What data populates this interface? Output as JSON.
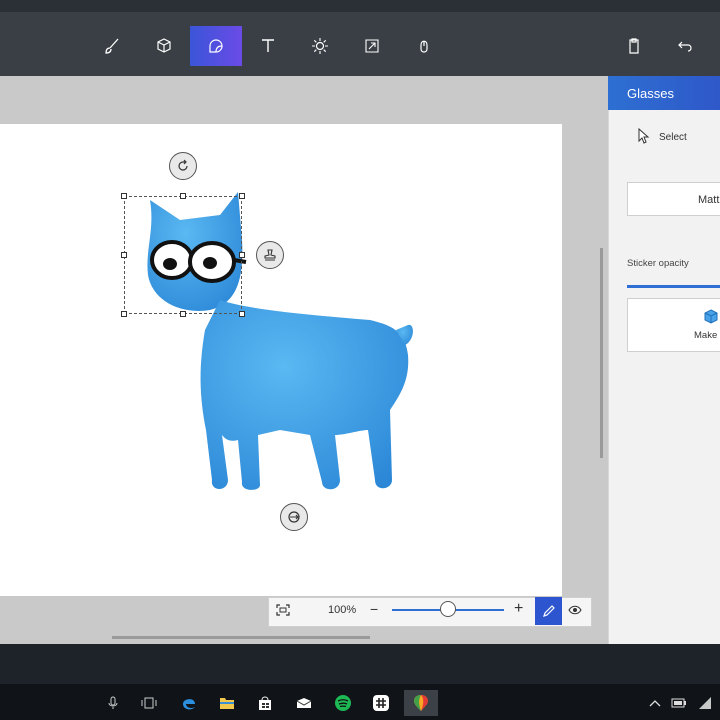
{
  "toolbar": {
    "tools": [
      {
        "name": "brushes",
        "icon": "brush-icon"
      },
      {
        "name": "3d-shapes",
        "icon": "cube-icon"
      },
      {
        "name": "stickers",
        "icon": "sticker-icon",
        "active": true
      },
      {
        "name": "text",
        "icon": "text-icon"
      },
      {
        "name": "effects",
        "icon": "sun-icon"
      },
      {
        "name": "canvas",
        "icon": "resize-icon"
      },
      {
        "name": "remix3d",
        "icon": "remix-icon"
      }
    ],
    "right_icons": [
      "paste-icon",
      "undo-icon"
    ]
  },
  "panel": {
    "title": "Glasses",
    "select_label": "Select",
    "matte_label": "Matt",
    "opacity_label": "Sticker opacity",
    "opacity": 1.0,
    "make_label": "Make"
  },
  "zoom": {
    "value_text": "100%",
    "minus": "−",
    "plus": "+",
    "level": 0.5
  },
  "colors": {
    "accent": "#2d6fd2",
    "model": "#3a9fe6"
  },
  "taskbar": {
    "icons": [
      "microphone-icon",
      "task-view-icon",
      "edge-icon",
      "file-explorer-icon",
      "store-icon",
      "mail-icon",
      "spotify-icon",
      "slack-icon",
      "paint3d-icon"
    ],
    "tray_icons": [
      "chevron-up-icon",
      "battery-icon",
      "wifi-icon"
    ]
  }
}
